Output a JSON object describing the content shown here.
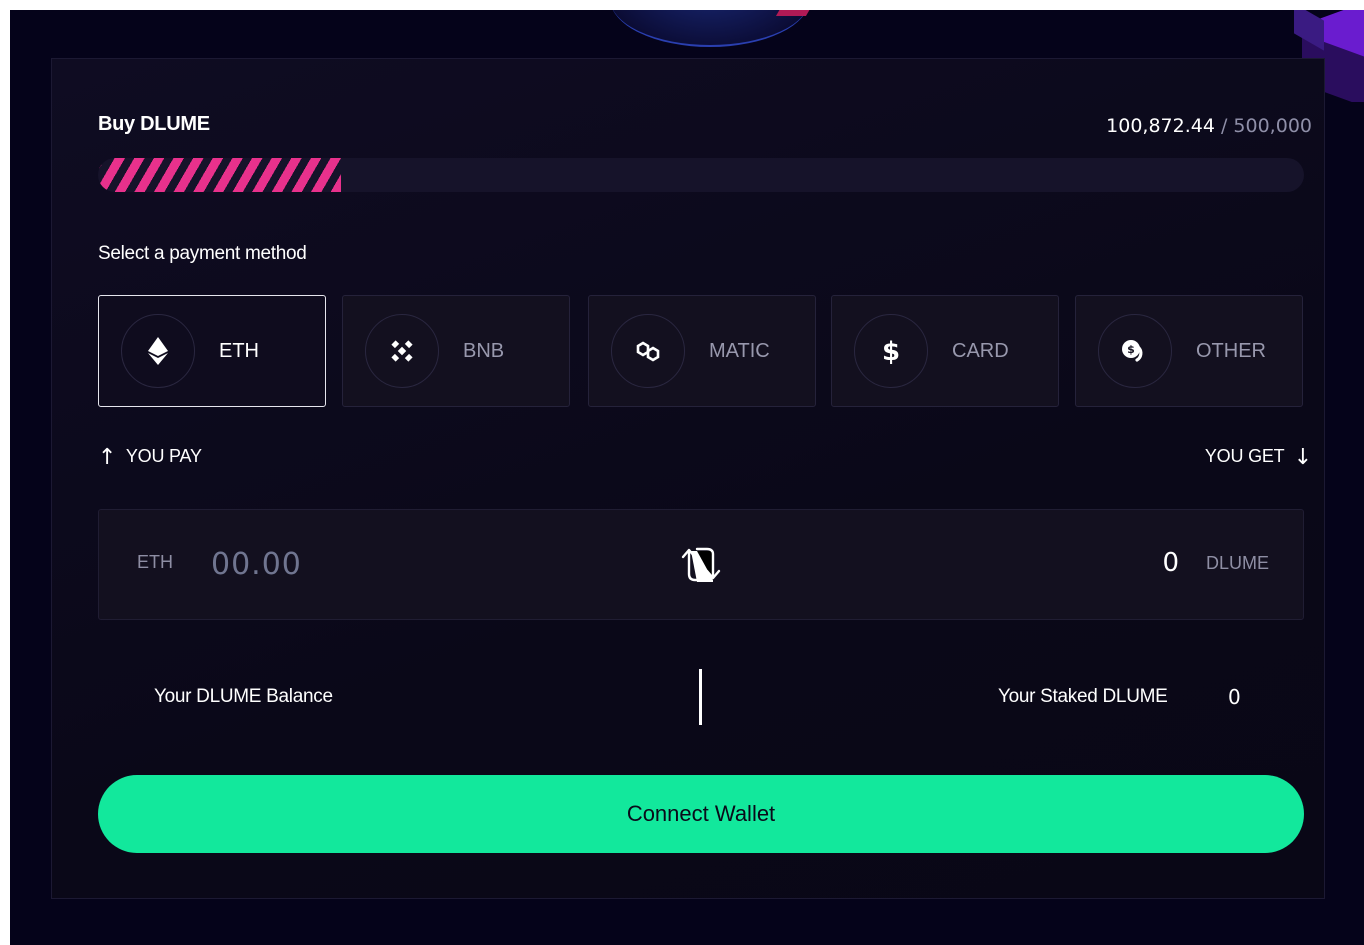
{
  "widget": {
    "title": "Buy DLUME",
    "raised": "100,872.44",
    "separator": " / ",
    "goal": "500,000",
    "progress_fraction": 0.2017
  },
  "payment": {
    "section_label": "Select a payment method",
    "selected": "ETH",
    "methods": [
      {
        "label": "ETH",
        "icon": "ethereum-icon"
      },
      {
        "label": "BNB",
        "icon": "bnb-icon"
      },
      {
        "label": "MATIC",
        "icon": "polygon-icon"
      },
      {
        "label": "CARD",
        "icon": "dollar-icon"
      },
      {
        "label": "OTHER",
        "icon": "coins-icon"
      }
    ]
  },
  "exchange": {
    "you_pay_label": "YOU PAY",
    "you_get_label": "YOU GET",
    "pay_currency": "ETH",
    "pay_placeholder": "00.00",
    "pay_value": "",
    "get_amount": "0",
    "get_currency": "DLUME"
  },
  "balances": {
    "balance_label": "Your DLUME Balance",
    "staked_label": "Your Staked DLUME",
    "staked_value": "0"
  },
  "actions": {
    "connect_label": "Connect Wallet"
  },
  "colors": {
    "accent": "#12e89c",
    "progress": "#e8318c",
    "background": "#05031a"
  }
}
